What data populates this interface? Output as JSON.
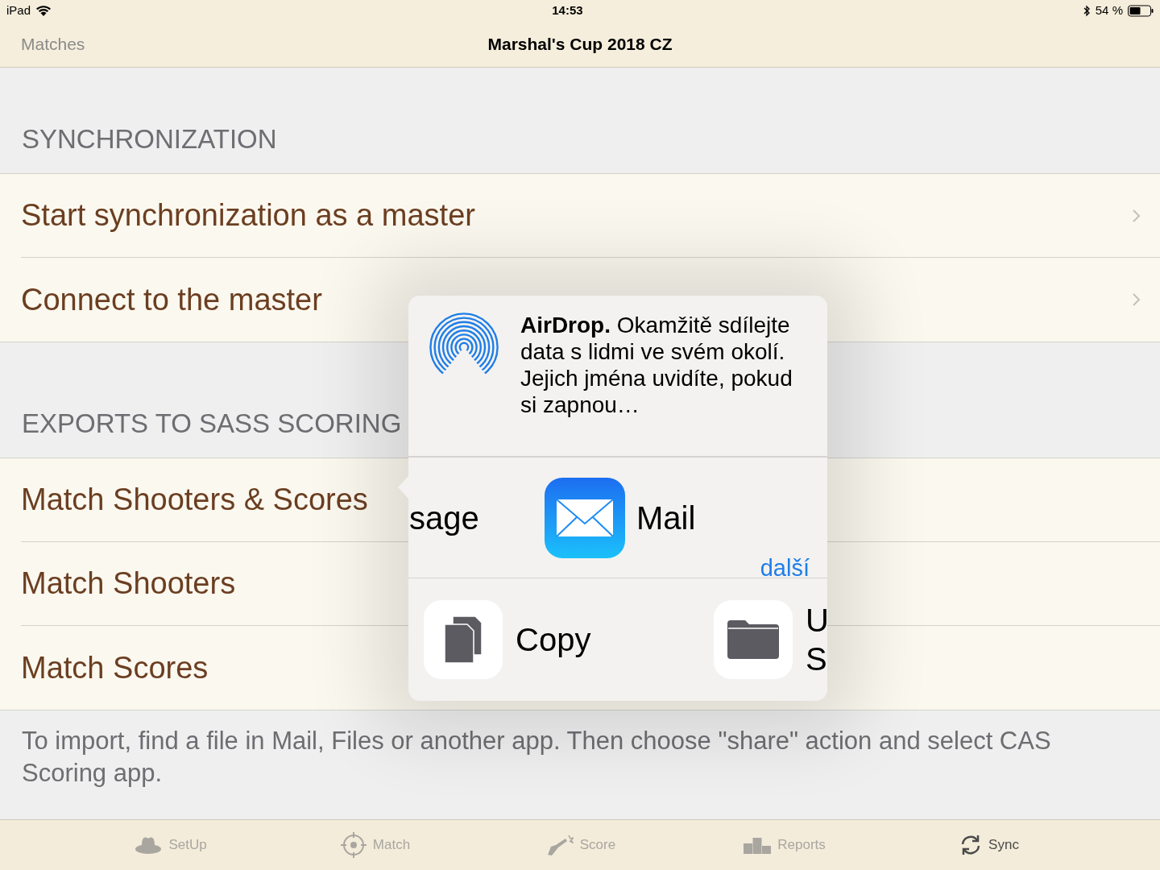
{
  "status_bar": {
    "device": "iPad",
    "time": "14:53",
    "battery": "54 %"
  },
  "nav": {
    "back": "Matches",
    "title": "Marshal's Cup 2018 CZ"
  },
  "sections": [
    {
      "header": "SYNCHRONIZATION",
      "rows": [
        {
          "label": "Start synchronization as a master",
          "disclosure": true
        },
        {
          "label": "Connect to the master",
          "disclosure": true
        }
      ]
    },
    {
      "header": "EXPORTS TO SASS SCORING",
      "rows": [
        {
          "label": "Match Shooters & Scores",
          "disclosure": false
        },
        {
          "label": "Match Shooters",
          "disclosure": false
        },
        {
          "label": "Match Scores",
          "disclosure": false
        }
      ],
      "footer": "To import, find a file in Mail, Files or another app. Then choose \"share\" action and select CAS Scoring app."
    }
  ],
  "share_sheet": {
    "airdrop_text": "**AirDrop.** Okamžitě sdílejte data s lidmi ve svém okolí. Jejich jména uvidíte, pokud si zapnou…",
    "apps": [
      {
        "kind": "clipped",
        "label": "sage"
      },
      {
        "kind": "mail",
        "label": "Mail"
      }
    ],
    "more": "další",
    "actions": [
      {
        "kind": "copy",
        "label": "Copy"
      },
      {
        "kind": "folder",
        "label_lines": [
          "U",
          "S"
        ]
      }
    ]
  },
  "tabs": [
    {
      "kind": "hat",
      "label": "SetUp",
      "selected": false
    },
    {
      "kind": "target",
      "label": "Match",
      "selected": false
    },
    {
      "kind": "gun",
      "label": "Score",
      "selected": false
    },
    {
      "kind": "podium",
      "label": "Reports",
      "selected": false
    },
    {
      "kind": "sync",
      "label": "Sync",
      "selected": true
    }
  ]
}
